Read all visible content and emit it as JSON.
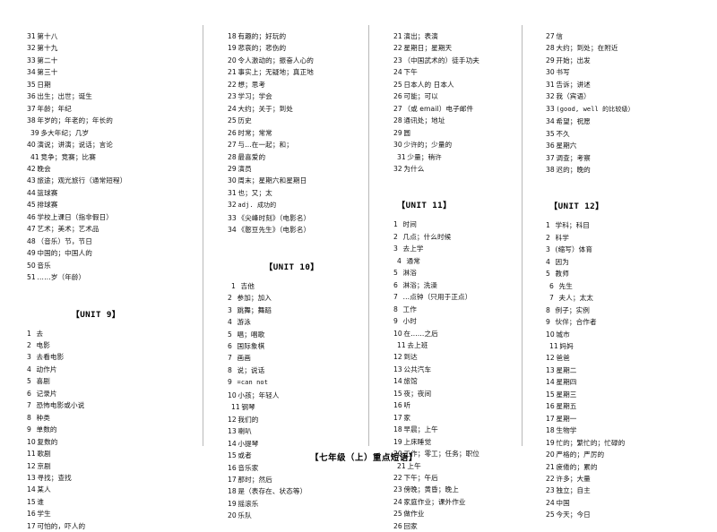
{
  "document": {
    "footer_title": "【七年级（上）重点短语】"
  },
  "columns": [
    {
      "id": "column-1",
      "blocks": [
        {
          "type": "list",
          "entries": [
            {
              "n": "31",
              "t": "第十八"
            },
            {
              "n": "32",
              "t": "第十九"
            },
            {
              "n": "33",
              "t": "第二十"
            },
            {
              "n": "34",
              "t": "第三十"
            },
            {
              "n": "35",
              "t": "日期"
            },
            {
              "n": "36",
              "t": "出生；出世；诞生"
            },
            {
              "n": "37",
              "t": "年龄；年纪"
            },
            {
              "n": "38",
              "t": "年岁的；年老的；年长的"
            },
            {
              "n": "39",
              "t": "多大年纪；几岁",
              "pad": true
            },
            {
              "n": "40",
              "t": "演说；讲演；说话；言论"
            },
            {
              "n": "41",
              "t": "竞争；竞赛；比赛",
              "pad": true
            },
            {
              "n": "42",
              "t": "晚会"
            },
            {
              "n": "43",
              "t": "旅途；观光旅行（通常短程）"
            },
            {
              "n": "44",
              "t": "篮球赛"
            },
            {
              "n": "45",
              "t": "排球赛"
            },
            {
              "n": "46",
              "t": "学校上课日（指非假日）"
            },
            {
              "n": "47",
              "t": "艺术；美术；艺术品"
            },
            {
              "n": "48",
              "t": "（音乐）节，节日"
            },
            {
              "n": "49",
              "t": "中国的；中国人的"
            },
            {
              "n": "50",
              "t": "音乐"
            },
            {
              "n": "51",
              "t": "……岁（年龄）"
            }
          ]
        },
        {
          "type": "heading",
          "label": "【UNIT 9】",
          "variant": "u9"
        },
        {
          "type": "list",
          "entries": [
            {
              "n": "1",
              "t": "去"
            },
            {
              "n": "2",
              "t": "电影"
            },
            {
              "n": "3",
              "t": "去看电影"
            },
            {
              "n": "4",
              "t": "动作片"
            },
            {
              "n": "5",
              "t": "喜剧"
            },
            {
              "n": "6",
              "t": "记录片"
            },
            {
              "n": "7",
              "t": "恐怖电影或小说"
            },
            {
              "n": "8",
              "t": "种类"
            },
            {
              "n": "9",
              "t": "单数的"
            },
            {
              "n": "10",
              "t": "复数的"
            },
            {
              "n": "11",
              "t": "歌剧"
            },
            {
              "n": "12",
              "t": "京剧"
            },
            {
              "n": "13",
              "t": "寻找；查找"
            },
            {
              "n": "14",
              "t": "某人"
            },
            {
              "n": "15",
              "t": "谁"
            },
            {
              "n": "16",
              "t": "学生"
            },
            {
              "n": "17",
              "t": "可怕的，吓人的"
            }
          ]
        }
      ]
    },
    {
      "id": "column-2",
      "blocks": [
        {
          "type": "list",
          "entries": [
            {
              "n": "18",
              "t": "有趣的；好玩的"
            },
            {
              "n": "19",
              "t": "悲哀的；悲伤的"
            },
            {
              "n": "20",
              "t": "令人激动的；振奋人心的"
            },
            {
              "n": "21",
              "t": "事实上；无疑地；真正地"
            },
            {
              "n": "22",
              "t": "想；思考"
            },
            {
              "n": "23",
              "t": "学习；学会"
            },
            {
              "n": "24",
              "t": "大约；关于；到处"
            },
            {
              "n": "25",
              "t": "历史"
            },
            {
              "n": "26",
              "t": "时常；常常"
            },
            {
              "n": "27",
              "t": "与…在一起；和；"
            },
            {
              "n": "28",
              "t": "最喜爱的"
            },
            {
              "n": "29",
              "t": "演员"
            },
            {
              "n": "30",
              "t": "周末；星期六和星期日"
            },
            {
              "n": "31",
              "t": "也；又；太"
            },
            {
              "n": "32",
              "t": "adj. 成功的",
              "latin": true
            },
            {
              "n": "33",
              "t": "《尖峰时刻》（电影名）"
            },
            {
              "n": "34",
              "t": "《憨豆先生》（电影名）"
            }
          ]
        },
        {
          "type": "heading",
          "label": "【UNIT 10】",
          "variant": "u10"
        },
        {
          "type": "list",
          "entries": [
            {
              "n": "1",
              "t": "吉他",
              "pad": true
            },
            {
              "n": "2",
              "t": "参加；加入"
            },
            {
              "n": "3",
              "t": "跳舞；舞蹈"
            },
            {
              "n": "4",
              "t": "游泳"
            },
            {
              "n": "5",
              "t": "唱；唱歌"
            },
            {
              "n": "6",
              "t": "国际象棋"
            },
            {
              "n": "7",
              "t": "画画"
            },
            {
              "n": "8",
              "t": "说；说话"
            },
            {
              "n": "9",
              "t": "=can not",
              "latin": true
            },
            {
              "n": "10",
              "t": "小孩；年轻人"
            },
            {
              "n": "11",
              "t": "钢琴",
              "pad": true
            },
            {
              "n": "12",
              "t": "我们的"
            },
            {
              "n": "13",
              "t": "喇叭"
            },
            {
              "n": "14",
              "t": "小提琴"
            },
            {
              "n": "15",
              "t": "或者"
            },
            {
              "n": "16",
              "t": "音乐家"
            },
            {
              "n": "17",
              "t": "那时；然后"
            },
            {
              "n": "18",
              "t": "是（表存在、状态等）"
            },
            {
              "n": "19",
              "t": "摇滚乐"
            },
            {
              "n": "20",
              "t": "乐队"
            }
          ]
        }
      ]
    },
    {
      "id": "column-3",
      "blocks": [
        {
          "type": "list",
          "entries": [
            {
              "n": "21",
              "t": "演出；表演"
            },
            {
              "n": "22",
              "t": "星期日；星期天"
            },
            {
              "n": "23",
              "t": "（中国武术的）徒手功夫"
            },
            {
              "n": "24",
              "t": "下午"
            },
            {
              "n": "25",
              "t": "日本人的  日本人"
            },
            {
              "n": "26",
              "t": "可能；可以"
            },
            {
              "n": "27",
              "t": "（或 email）电子邮件"
            },
            {
              "n": "28",
              "t": "通讯处；地址"
            },
            {
              "n": "29",
              "t": "圆"
            },
            {
              "n": "30",
              "t": "少许的；少量的"
            },
            {
              "n": "31",
              "t": "少量；稍许",
              "pad": true
            },
            {
              "n": "32",
              "t": "为什么"
            }
          ]
        },
        {
          "type": "heading",
          "label": "【UNIT 11】",
          "variant": "u11"
        },
        {
          "type": "list",
          "entries": [
            {
              "n": "1",
              "t": "时间"
            },
            {
              "n": "2",
              "t": "几点；什么时候"
            },
            {
              "n": "3",
              "t": "去上学"
            },
            {
              "n": "4",
              "t": "通常",
              "pad": true
            },
            {
              "n": "5",
              "t": "淋浴"
            },
            {
              "n": "6",
              "t": "淋浴；洗澡"
            },
            {
              "n": "7",
              "t": "…点钟（只用于正点）"
            },
            {
              "n": "8",
              "t": "工作"
            },
            {
              "n": "9",
              "t": "小时"
            },
            {
              "n": "10",
              "t": "在……之后"
            },
            {
              "n": "11",
              "t": "去上班",
              "pad": true
            },
            {
              "n": "12",
              "t": "到达"
            },
            {
              "n": "13",
              "t": "公共汽车"
            },
            {
              "n": "14",
              "t": "旅馆"
            },
            {
              "n": "15",
              "t": "夜；夜间"
            },
            {
              "n": "16",
              "t": "听"
            },
            {
              "n": "17",
              "t": "家"
            },
            {
              "n": "18",
              "t": "早晨；上午"
            },
            {
              "n": "19",
              "t": "上床睡觉"
            },
            {
              "n": "20",
              "t": "工作；零工；任务；职位"
            },
            {
              "n": "21",
              "t": "上午",
              "pad": true
            },
            {
              "n": "22",
              "t": "下午；午后"
            },
            {
              "n": "23",
              "t": "傍晚；黄昏；晚上"
            },
            {
              "n": "24",
              "t": "家庭作业；课外作业"
            },
            {
              "n": "25",
              "t": "做作业"
            },
            {
              "n": "26",
              "t": "回家"
            }
          ]
        }
      ]
    },
    {
      "id": "column-4",
      "blocks": [
        {
          "type": "list",
          "entries": [
            {
              "n": "27",
              "t": "信"
            },
            {
              "n": "28",
              "t": "大约；到处；在附近"
            },
            {
              "n": "29",
              "t": "开始；出发"
            },
            {
              "n": "30",
              "t": "书写"
            },
            {
              "n": "31",
              "t": "告诉；讲述"
            },
            {
              "n": "32",
              "t": "我（宾语）"
            },
            {
              "n": "33",
              "t": "(good, well 的比较级）",
              "latin": true
            },
            {
              "n": "34",
              "t": "希望；祝愿"
            },
            {
              "n": "35",
              "t": "不久"
            },
            {
              "n": "36",
              "t": "星期六"
            },
            {
              "n": "37",
              "t": "调查；考察"
            },
            {
              "n": "38",
              "t": "迟的；晚的"
            }
          ]
        },
        {
          "type": "heading",
          "label": "【UNIT 12】",
          "variant": "u12"
        },
        {
          "type": "list",
          "entries": [
            {
              "n": "1",
              "t": "学科；科目"
            },
            {
              "n": "2",
              "t": "科学"
            },
            {
              "n": "3",
              "t": "(缩写）体育"
            },
            {
              "n": "4",
              "t": "因为"
            },
            {
              "n": "5",
              "t": "教师"
            },
            {
              "n": "6",
              "t": "先生",
              "pad": true
            },
            {
              "n": "7",
              "t": "夫人；太太",
              "pad": true
            },
            {
              "n": "8",
              "t": "例子；实例"
            },
            {
              "n": "9",
              "t": "伙伴；合作者"
            },
            {
              "n": "10",
              "t": "城市"
            },
            {
              "n": "11",
              "t": "妈妈",
              "pad": true
            },
            {
              "n": "12",
              "t": "爸爸"
            },
            {
              "n": "13",
              "t": "星期二"
            },
            {
              "n": "14",
              "t": "星期四"
            },
            {
              "n": "15",
              "t": "星期三"
            },
            {
              "n": "16",
              "t": "星期五"
            },
            {
              "n": "17",
              "t": "星期一"
            },
            {
              "n": "18",
              "t": "生物学"
            },
            {
              "n": "19",
              "t": "忙的；繁忙的；忙碌的"
            },
            {
              "n": "20",
              "t": "严格的；严厉的"
            },
            {
              "n": "21",
              "t": "疲倦的；累的"
            },
            {
              "n": "22",
              "t": "许多；大量"
            },
            {
              "n": "23",
              "t": "独立；自主"
            },
            {
              "n": "24",
              "t": "中国"
            },
            {
              "n": "25",
              "t": "今天；今日"
            }
          ]
        }
      ]
    }
  ]
}
